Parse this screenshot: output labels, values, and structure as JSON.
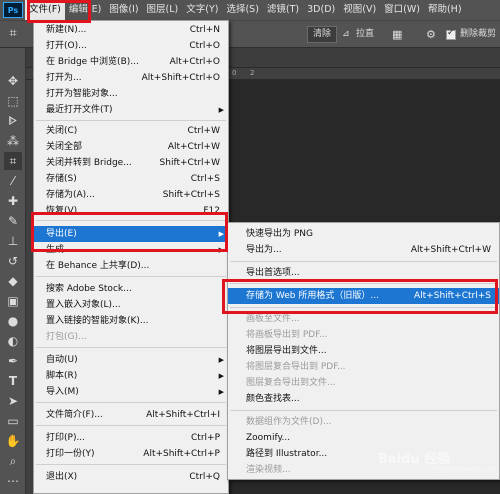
{
  "app": {
    "icon": "Ps"
  },
  "menubar": [
    {
      "label": "文件(F)",
      "active": true
    },
    {
      "label": "编辑(E)"
    },
    {
      "label": "图像(I)"
    },
    {
      "label": "图层(L)"
    },
    {
      "label": "文字(Y)"
    },
    {
      "label": "选择(S)"
    },
    {
      "label": "滤镜(T)"
    },
    {
      "label": "3D(D)"
    },
    {
      "label": "视图(V)"
    },
    {
      "label": "窗口(W)"
    },
    {
      "label": "帮助(H)"
    }
  ],
  "optionsbar": {
    "clear": "清除",
    "straighten": "拉直",
    "delete_cropped": "删除裁剪"
  },
  "ruler_ticks": [
    "0",
    "2"
  ],
  "file_menu": {
    "new": {
      "label": "新建(N)...",
      "shortcut": "Ctrl+N"
    },
    "open": {
      "label": "打开(O)...",
      "shortcut": "Ctrl+O"
    },
    "browse_bridge": {
      "label": "在 Bridge 中浏览(B)...",
      "shortcut": "Alt+Ctrl+O"
    },
    "open_as": {
      "label": "打开为...",
      "shortcut": "Alt+Shift+Ctrl+O"
    },
    "open_smart": {
      "label": "打开为智能对象..."
    },
    "open_recent": {
      "label": "最近打开文件(T)"
    },
    "close": {
      "label": "关闭(C)",
      "shortcut": "Ctrl+W"
    },
    "close_all": {
      "label": "关闭全部",
      "shortcut": "Alt+Ctrl+W"
    },
    "close_go_bridge": {
      "label": "关闭并转到 Bridge...",
      "shortcut": "Shift+Ctrl+W"
    },
    "save": {
      "label": "存储(S)",
      "shortcut": "Ctrl+S"
    },
    "save_as": {
      "label": "存储为(A)...",
      "shortcut": "Shift+Ctrl+S"
    },
    "revert": {
      "label": "恢复(V)",
      "shortcut": "F12"
    },
    "export": {
      "label": "导出(E)"
    },
    "generate": {
      "label": "生成"
    },
    "behance": {
      "label": "在 Behance 上共享(D)..."
    },
    "search_stock": {
      "label": "搜索 Adobe Stock..."
    },
    "place_embedded": {
      "label": "置入嵌入对象(L)..."
    },
    "place_linked": {
      "label": "置入链接的智能对象(K)..."
    },
    "package": {
      "label": "打包(G)..."
    },
    "automate": {
      "label": "自动(U)"
    },
    "scripts": {
      "label": "脚本(R)"
    },
    "import": {
      "label": "导入(M)"
    },
    "file_info": {
      "label": "文件简介(F)...",
      "shortcut": "Alt+Shift+Ctrl+I"
    },
    "print": {
      "label": "打印(P)...",
      "shortcut": "Ctrl+P"
    },
    "print_one": {
      "label": "打印一份(Y)",
      "shortcut": "Alt+Shift+Ctrl+P"
    },
    "exit": {
      "label": "退出(X)",
      "shortcut": "Ctrl+Q"
    }
  },
  "export_menu": {
    "quick_png": {
      "label": "快速导出为 PNG"
    },
    "export_as": {
      "label": "导出为...",
      "shortcut": "Alt+Shift+Ctrl+W"
    },
    "export_prefs": {
      "label": "导出首选项..."
    },
    "save_for_web": {
      "label": "存储为 Web 所用格式（旧版）...",
      "shortcut": "Alt+Shift+Ctrl+S"
    },
    "artboards_files": {
      "label": "画板至文件..."
    },
    "artboards_pdf": {
      "label": "将画板导出到 PDF..."
    },
    "layers_files": {
      "label": "将图层导出到文件..."
    },
    "layer_comps_pdf": {
      "label": "将图层复合导出到 PDF..."
    },
    "layer_comps_files": {
      "label": "图层复合导出到文件..."
    },
    "color_lookup": {
      "label": "颜色查找表..."
    },
    "data_sets": {
      "label": "数据组作为文件(D)..."
    },
    "zoomify": {
      "label": "Zoomify..."
    },
    "paths_illustrator": {
      "label": "路径到 Illustrator..."
    },
    "render_video": {
      "label": "渲染视频..."
    }
  },
  "watermark": {
    "main": "Baidu 经验",
    "sub": "jingyan.baidu.com"
  },
  "colors": {
    "highlight": "#1c76d2",
    "annotation": "#e0141e"
  }
}
